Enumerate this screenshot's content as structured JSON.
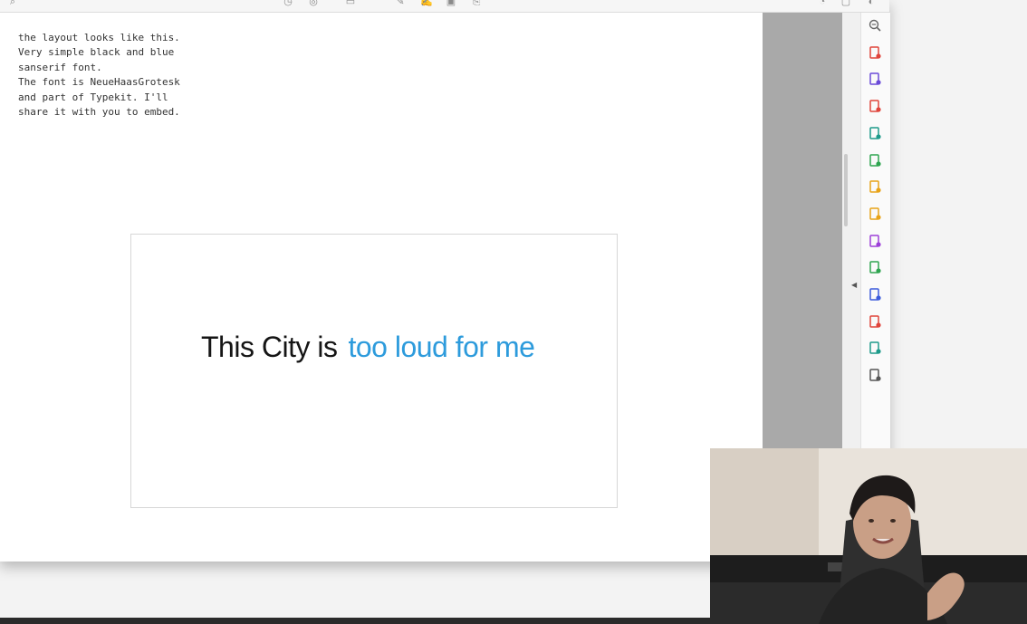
{
  "note": {
    "text": "the layout looks like this.\nVery simple black and blue\nsanserif font.\nThe font is NeueHaasGrotesk\nand part of Typekit. I'll\nshare it with you to embed."
  },
  "slide": {
    "black_text": "This City is",
    "blue_text": "too loud for me",
    "black_color": "#151515",
    "blue_color": "#2d9bdc"
  },
  "toolbar": {
    "icons": [
      "search-icon",
      "clock-icon",
      "help-icon",
      "comment-icon",
      "pen-icon",
      "image-icon",
      "edit-icon",
      "share-icon"
    ]
  },
  "tools": [
    {
      "name": "zoom-out-icon",
      "color": "#666666"
    },
    {
      "name": "export-pdf-icon",
      "color": "#e0443b"
    },
    {
      "name": "create-pdf-icon",
      "color": "#6a4ad8"
    },
    {
      "name": "organize-pages-icon",
      "color": "#e0443b"
    },
    {
      "name": "combine-files-icon",
      "color": "#1d9a8a"
    },
    {
      "name": "spreadsheet-icon",
      "color": "#2ea44f"
    },
    {
      "name": "rich-media-icon",
      "color": "#e8a317"
    },
    {
      "name": "comment-tool-icon",
      "color": "#e8a317"
    },
    {
      "name": "fill-sign-icon",
      "color": "#9c3fd8"
    },
    {
      "name": "print-production-icon",
      "color": "#2ea44f"
    },
    {
      "name": "protect-icon",
      "color": "#3b5bdb"
    },
    {
      "name": "redact-icon",
      "color": "#e0443b"
    },
    {
      "name": "scan-ocr-icon",
      "color": "#1d9a8a"
    },
    {
      "name": "more-tools-icon",
      "color": "#555555"
    }
  ]
}
